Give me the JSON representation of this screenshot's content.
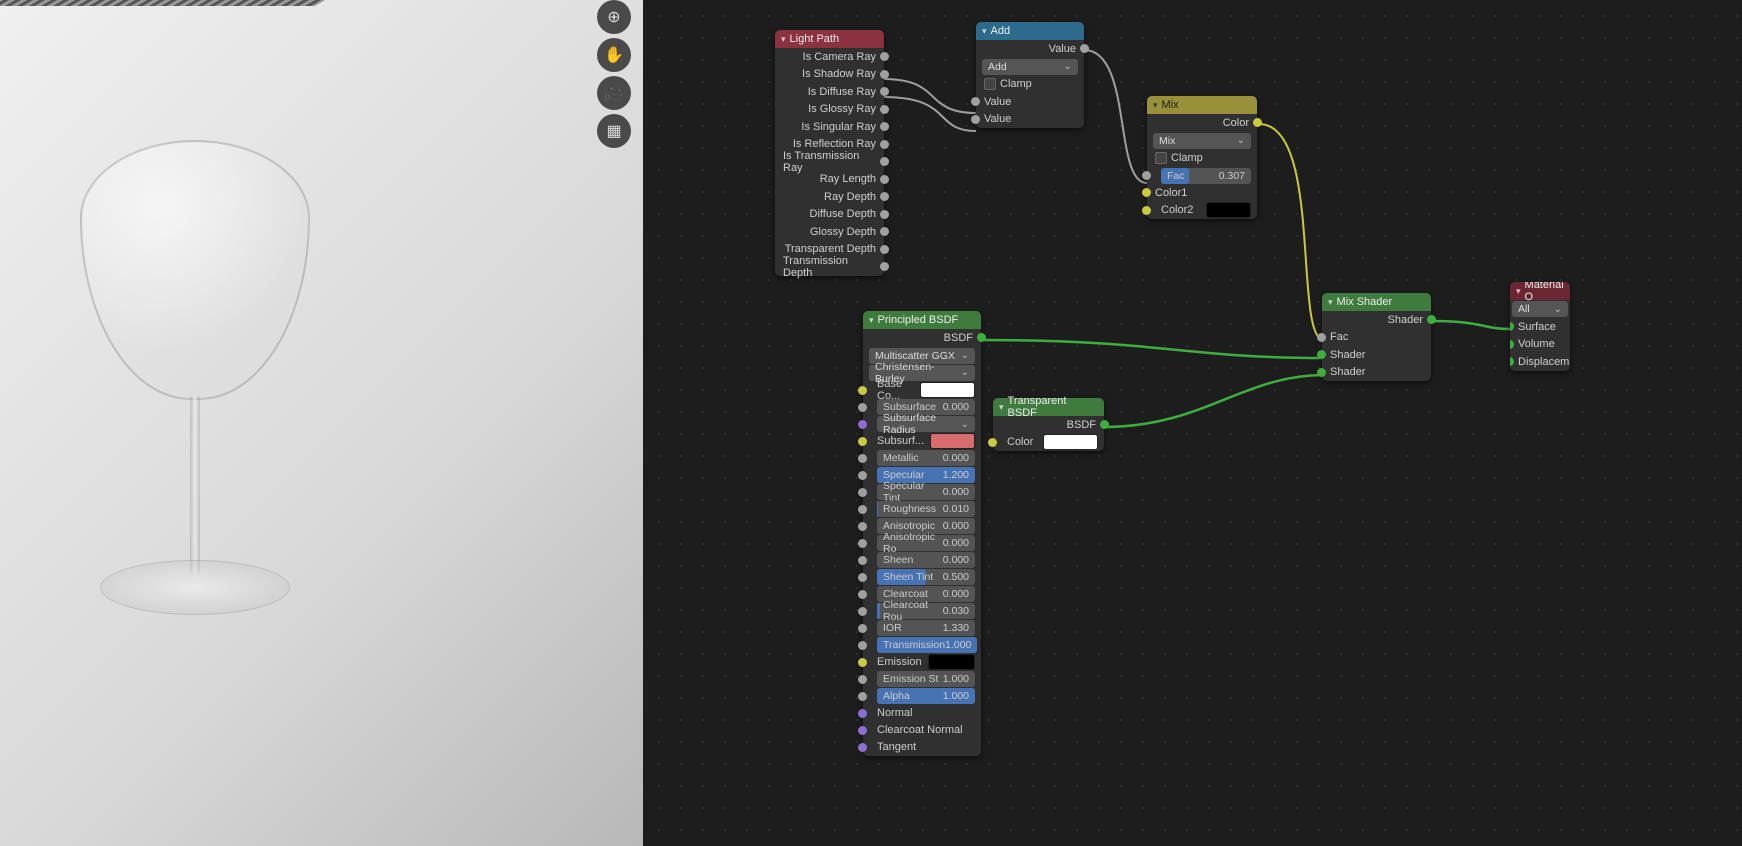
{
  "viewport_buttons": [
    "zoom",
    "pan",
    "camera",
    "grid"
  ],
  "nodes": {
    "light_path": {
      "title": "Light Path",
      "outputs": [
        "Is Camera Ray",
        "Is Shadow Ray",
        "Is Diffuse Ray",
        "Is Glossy Ray",
        "Is Singular Ray",
        "Is Reflection Ray",
        "Is Transmission Ray",
        "Ray Length",
        "Ray Depth",
        "Diffuse Depth",
        "Glossy Depth",
        "Transparent Depth",
        "Transmission Depth"
      ]
    },
    "add": {
      "title": "Add",
      "out": "Value",
      "mode": "Add",
      "clamp": "Clamp",
      "in1": "Value",
      "in2": "Value"
    },
    "mix": {
      "title": "Mix",
      "out": "Color",
      "mode": "Mix",
      "clamp": "Clamp",
      "fac_label": "Fac",
      "fac_value": "0.307",
      "fac_fill": 30.7,
      "color1": "Color1",
      "color2": "Color2",
      "color2_swatch": "#000000"
    },
    "principled": {
      "title": "Principled BSDF",
      "out": "BSDF",
      "distribution": "Multiscatter GGX",
      "sss": "Christensen-Burley",
      "rows": [
        {
          "kind": "colorrow",
          "label": "Base Co...",
          "sock": "s-yellow",
          "swatch": "#ffffff"
        },
        {
          "kind": "slider",
          "label": "Subsurface",
          "value": "0.000",
          "fill": 0,
          "sock": "s-grey"
        },
        {
          "kind": "labelonly",
          "label": "Subsurface Radius",
          "sock": "s-purple",
          "sel": true
        },
        {
          "kind": "colorrow",
          "label": "Subsurf...",
          "sock": "s-yellow",
          "swatch": "#d76d6d"
        },
        {
          "kind": "slider",
          "label": "Metallic",
          "value": "0.000",
          "fill": 0,
          "sock": "s-grey"
        },
        {
          "kind": "slider",
          "label": "Specular",
          "value": "1.200",
          "fill": 100,
          "sock": "s-grey"
        },
        {
          "kind": "slider",
          "label": "Specular Tint",
          "value": "0.000",
          "fill": 0,
          "sock": "s-grey"
        },
        {
          "kind": "slider",
          "label": "Roughness",
          "value": "0.010",
          "fill": 1,
          "sock": "s-grey"
        },
        {
          "kind": "slider",
          "label": "Anisotropic",
          "value": "0.000",
          "fill": 0,
          "sock": "s-grey"
        },
        {
          "kind": "slider",
          "label": "Anisotropic Ro",
          "value": "0.000",
          "fill": 0,
          "sock": "s-grey"
        },
        {
          "kind": "slider",
          "label": "Sheen",
          "value": "0.000",
          "fill": 0,
          "sock": "s-grey"
        },
        {
          "kind": "slider",
          "label": "Sheen Tint",
          "value": "0.500",
          "fill": 50,
          "sock": "s-grey"
        },
        {
          "kind": "slider",
          "label": "Clearcoat",
          "value": "0.000",
          "fill": 0,
          "sock": "s-grey"
        },
        {
          "kind": "slider",
          "label": "Clearcoat Rou",
          "value": "0.030",
          "fill": 3,
          "sock": "s-grey"
        },
        {
          "kind": "slider",
          "label": "IOR",
          "value": "1.330",
          "fill": 0,
          "sock": "s-grey",
          "center": true
        },
        {
          "kind": "slider",
          "label": "Transmission",
          "value": "1.000",
          "fill": 100,
          "sock": "s-grey"
        },
        {
          "kind": "colorrow",
          "label": "Emission",
          "sock": "s-yellow",
          "swatch": "#000000"
        },
        {
          "kind": "slider",
          "label": "Emission St",
          "value": "1.000",
          "fill": 0,
          "sock": "s-grey",
          "center": true
        },
        {
          "kind": "slider",
          "label": "Alpha",
          "value": "1.000",
          "fill": 100,
          "sock": "s-grey"
        },
        {
          "kind": "plain",
          "label": "Normal",
          "sock": "s-purple"
        },
        {
          "kind": "plain",
          "label": "Clearcoat Normal",
          "sock": "s-purple"
        },
        {
          "kind": "plain",
          "label": "Tangent",
          "sock": "s-purple"
        }
      ]
    },
    "transparent": {
      "title": "Transparent BSDF",
      "out": "BSDF",
      "color": "Color",
      "swatch": "#ffffff"
    },
    "mix_shader": {
      "title": "Mix Shader",
      "out": "Shader",
      "fac": "Fac",
      "in1": "Shader",
      "in2": "Shader"
    },
    "material_output": {
      "title": "Material O",
      "mode": "All",
      "ins": [
        "Surface",
        "Volume",
        "Displacement"
      ]
    }
  }
}
